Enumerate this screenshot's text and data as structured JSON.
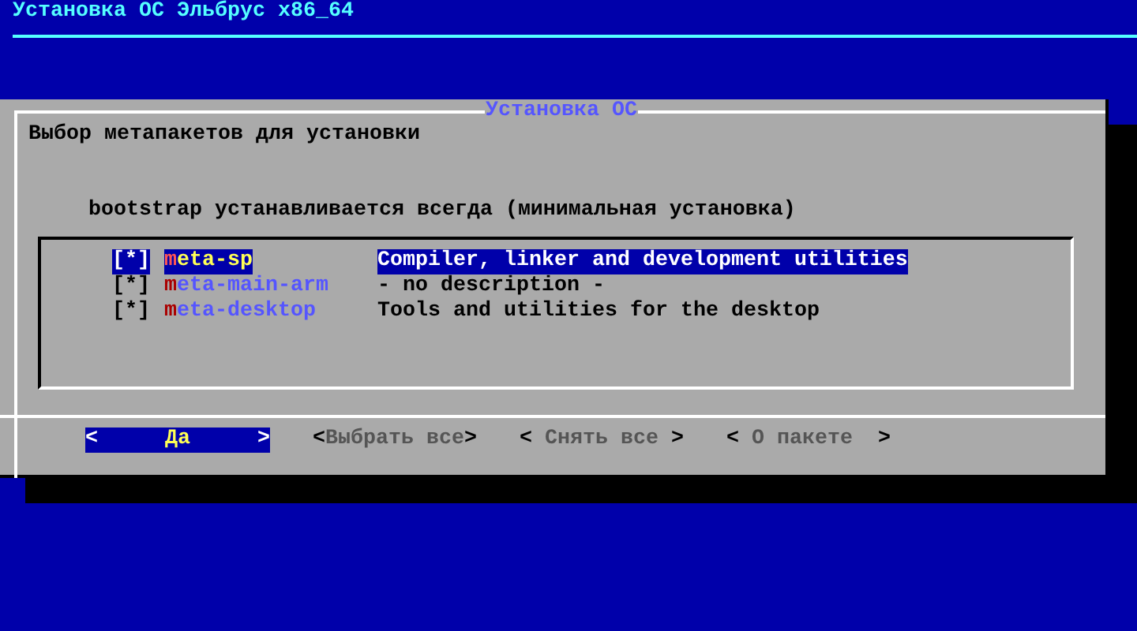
{
  "screen_title": "Установка ОС Эльбрус x86_64",
  "dialog": {
    "title": "Установка ОС",
    "prompt": "Выбор метапакетов для установки",
    "note": "bootstrap устанавливается всегда (минимальная установка)",
    "items": [
      {
        "mark": "[*]",
        "name": "meta-sp",
        "description": "Compiler, linker and development utilities",
        "selected": true
      },
      {
        "mark": "[*]",
        "name": "meta-main-arm",
        "description": "- no description -",
        "selected": false
      },
      {
        "mark": "[*]",
        "name": "meta-desktop",
        "description": "Tools and utilities for the desktop",
        "selected": false
      }
    ],
    "buttons": [
      {
        "left": "<",
        "label": "Да",
        "right": ">",
        "selected": true
      },
      {
        "left": "<",
        "label": "Выбрать все",
        "right": ">",
        "selected": false
      },
      {
        "left": "< ",
        "label": "Снять все",
        "right": " >",
        "selected": false
      },
      {
        "left": "< ",
        "label": "О пакете",
        "right": "  >",
        "selected": false
      }
    ]
  }
}
